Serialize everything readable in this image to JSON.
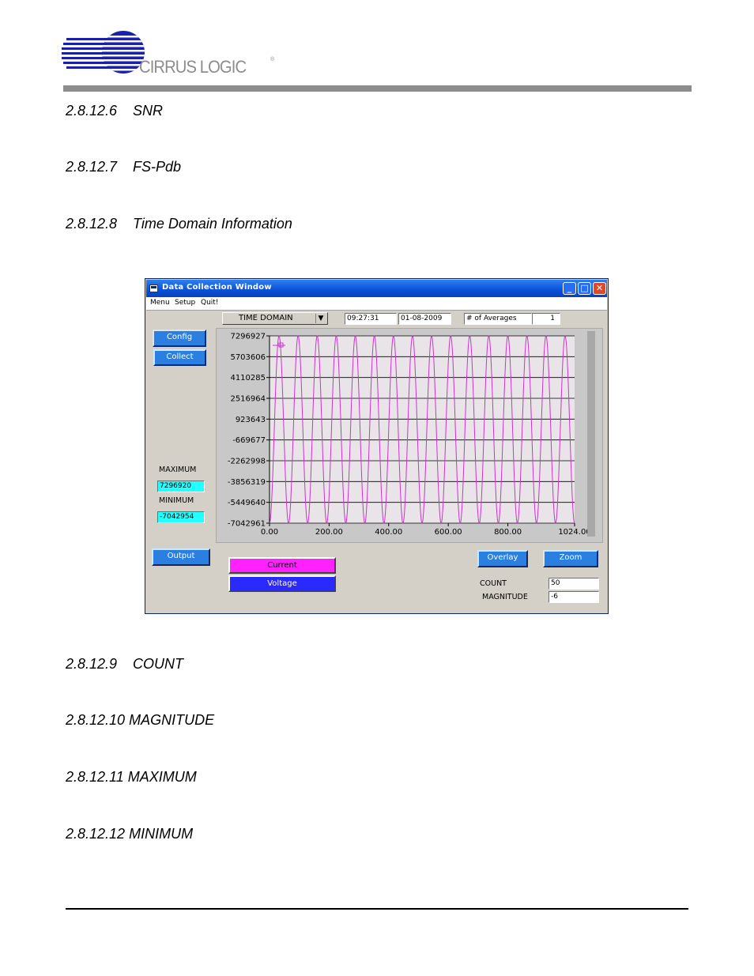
{
  "header": {
    "logo_text": "CIRRUS LOGIC",
    "logo_mark": "®"
  },
  "sections_top": [
    {
      "number": "2.8.12.6",
      "title": "SNR"
    },
    {
      "number": "2.8.12.7",
      "title": "FS-Pdb"
    },
    {
      "number": "2.8.12.8",
      "title": "Time Domain Information"
    }
  ],
  "sections_bottom": [
    {
      "number": "2.8.12.9",
      "title": "COUNT"
    },
    {
      "number": "2.8.12.10",
      "title": "MAGNITUDE"
    },
    {
      "number": "2.8.12.11",
      "title": "MAXIMUM"
    },
    {
      "number": "2.8.12.12",
      "title": "MINIMUM"
    }
  ],
  "window": {
    "title": "Data Collection Window",
    "controls": {
      "minimize": "_",
      "maximize": "□",
      "close": "✕"
    },
    "menu": [
      "Menu",
      "Setup",
      "Quit!"
    ],
    "mode_select": "TIME DOMAIN",
    "time": "09:27:31",
    "date": "01-08-2009",
    "averages_label": "# of Averages",
    "averages_value": "1",
    "buttons": {
      "config": "Config",
      "collect": "Collect",
      "output": "Output",
      "overlay": "Overlay",
      "zoom": "Zoom"
    },
    "maximum_label": "MAXIMUM",
    "maximum_value": "7296920",
    "minimum_label": "MINIMUM",
    "minimum_value": "-7042954",
    "legend": {
      "current": "Current",
      "voltage": "Voltage"
    },
    "count_label": "COUNT",
    "count_value": "50",
    "magnitude_label": "MAGNITUDE",
    "magnitude_value": "-6",
    "colors": {
      "current": "#ff22ff",
      "voltage": "#2a2aff",
      "trace": "#cc33cc",
      "plot_bg": "#e8e4e8",
      "title_bar": "#0a50d8"
    }
  },
  "chart_data": {
    "type": "line",
    "title": "",
    "xlabel": "",
    "ylabel": "",
    "xlim": [
      0,
      1024
    ],
    "ylim": [
      -7042961,
      7296927
    ],
    "x_ticks": [
      "0.00",
      "200.00",
      "400.00",
      "600.00",
      "800.00",
      "1024.00"
    ],
    "x_tick_values": [
      0,
      200,
      400,
      600,
      800,
      1024
    ],
    "y_ticks": [
      "7296927",
      "5703606",
      "4110285",
      "2516964",
      "923643",
      "-669677",
      "-2262998",
      "-3856319",
      "-5449640",
      "-7042961"
    ],
    "y_tick_values": [
      7296927,
      5703606,
      4110285,
      2516964,
      923643,
      -669677,
      -2262998,
      -3856319,
      -5449640,
      -7042961
    ],
    "series": [
      {
        "amplitude_max": 7296920,
        "amplitude_min": -7042954,
        "cycles": 16,
        "color": "#cc33cc"
      }
    ],
    "grid": true
  }
}
